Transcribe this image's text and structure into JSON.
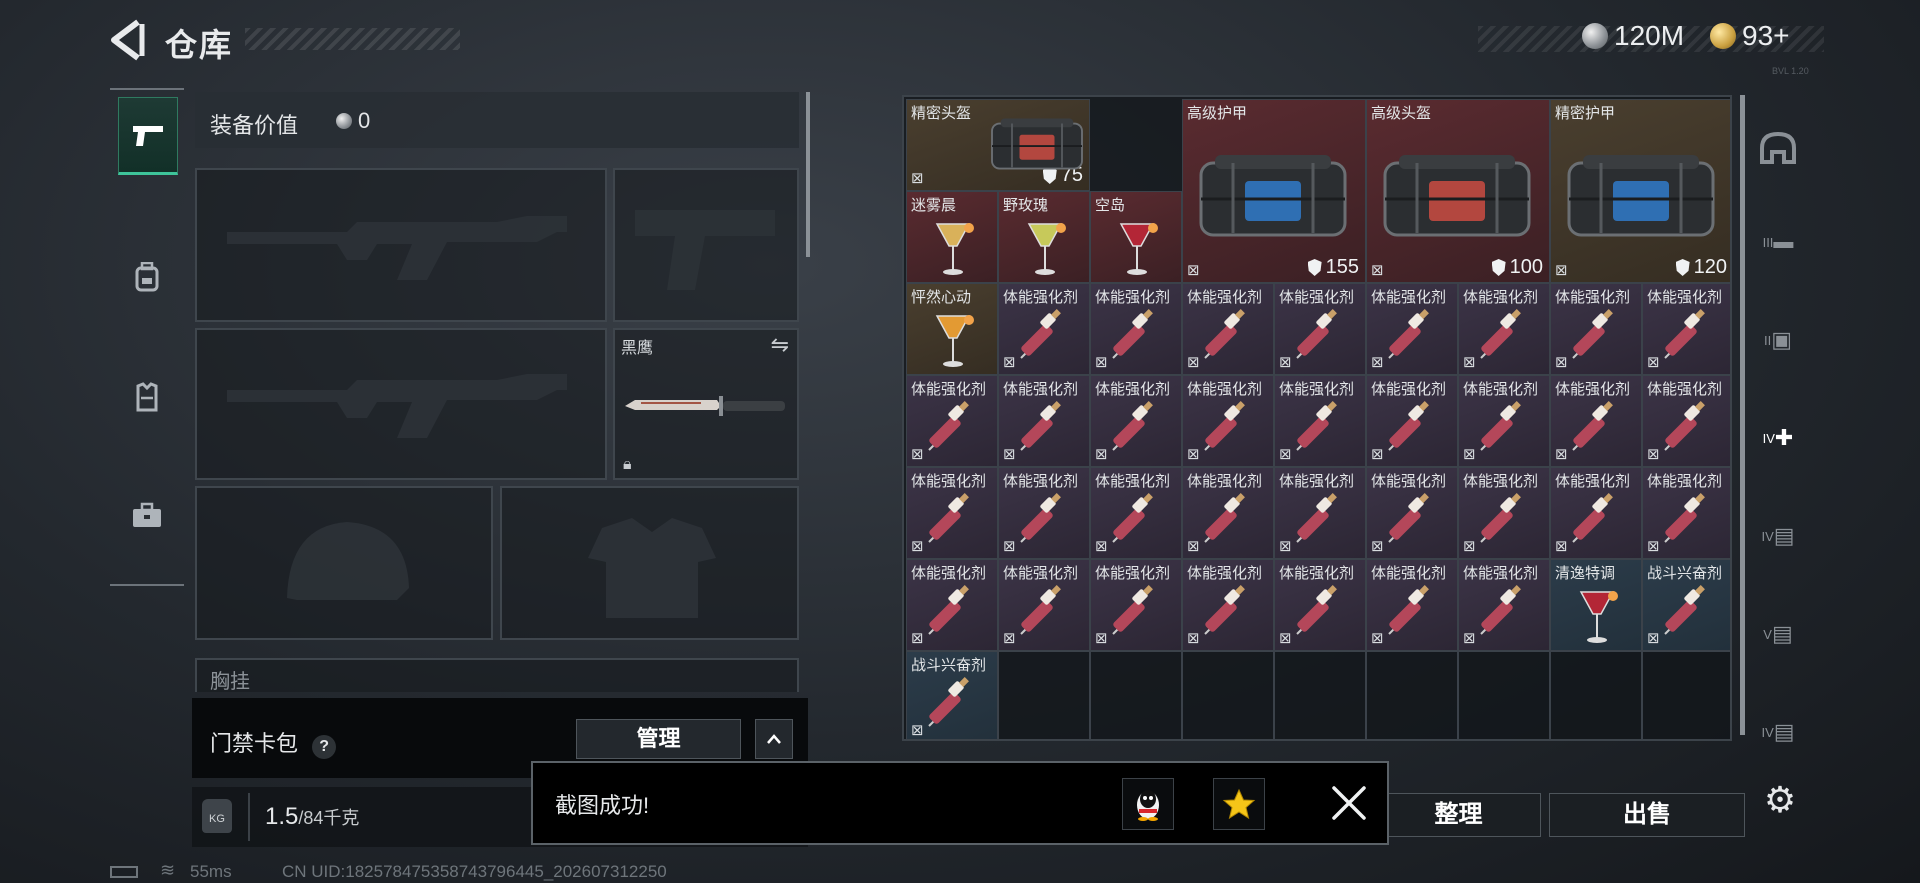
{
  "header": {
    "title": "仓库"
  },
  "currency": {
    "silver": "120M",
    "gold": "93+"
  },
  "corner_tag": "BVL 1.20",
  "equipment": {
    "value_label": "装备价值",
    "value": "0",
    "knife_name": "黑鹰",
    "chest_label": "胸挂"
  },
  "keycard": {
    "label": "门禁卡包",
    "help": "?",
    "manage": "管理"
  },
  "weight": {
    "current": "1.5",
    "max": "/84千克",
    "icon": "KG"
  },
  "grid": {
    "top_items": [
      {
        "name": "精密头盔",
        "durability": "75"
      },
      {
        "name": "高级护甲",
        "durability": "155"
      },
      {
        "name": "高级头盔",
        "durability": "100"
      },
      {
        "name": "精密护甲",
        "durability": "120"
      }
    ],
    "drinks": [
      "迷雾晨",
      "野玫瑰",
      "空岛"
    ],
    "single_items": [
      "怦然心动",
      "清逸特调",
      "战斗兴奋剂",
      "战斗兴奋剂"
    ],
    "stim_name": "体能强化剂"
  },
  "actions": {
    "sort": "整理",
    "sell": "出售"
  },
  "toast": {
    "message": "截图成功!"
  },
  "status": {
    "ping": "55ms",
    "uid": "CN UID:18257847535874379644​5_202607312250"
  },
  "right_tabs": [
    "III",
    "II",
    "IV",
    "IV",
    "V",
    "IV"
  ],
  "colors": {
    "accent": "#3ec49a",
    "rarity_gold": "#4a3f2f",
    "rarity_red": "#5a2b30",
    "rarity_purple": "#3c3447",
    "rarity_blue": "#2c3c4a"
  }
}
